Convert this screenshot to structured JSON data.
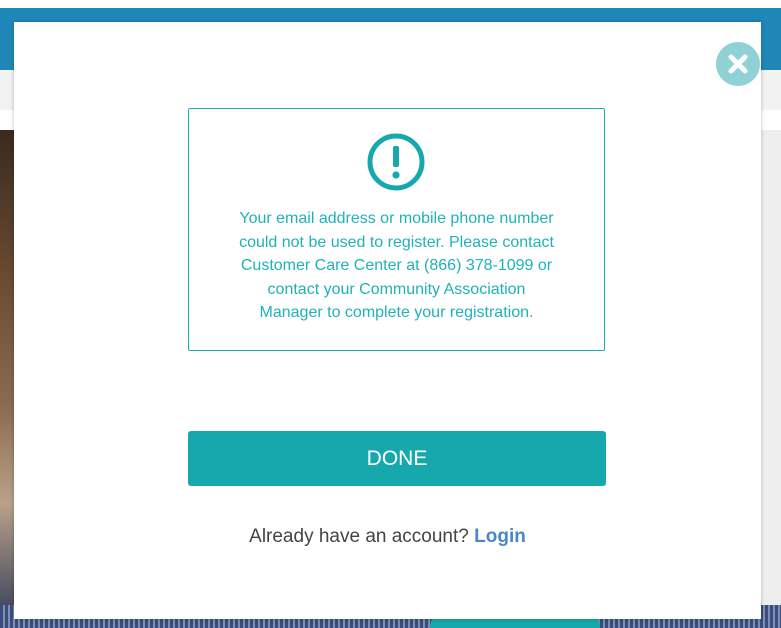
{
  "modal": {
    "message_lines": [
      "Your email address or mobile phone number",
      "could not be used to register. Please contact",
      "Customer Care Center at (866) 378-1099 or",
      "contact your Community Association",
      "Manager to complete your registration."
    ],
    "done_label": "DONE",
    "login_prompt": "Already have an account?",
    "login_link": "Login",
    "close_icon": "close-icon",
    "alert_icon": "exclamation-circle-icon"
  },
  "colors": {
    "accent": "#17a8ad",
    "close_bg": "#8ed2d5",
    "link": "#4a86c8",
    "text_dark": "#444444"
  }
}
